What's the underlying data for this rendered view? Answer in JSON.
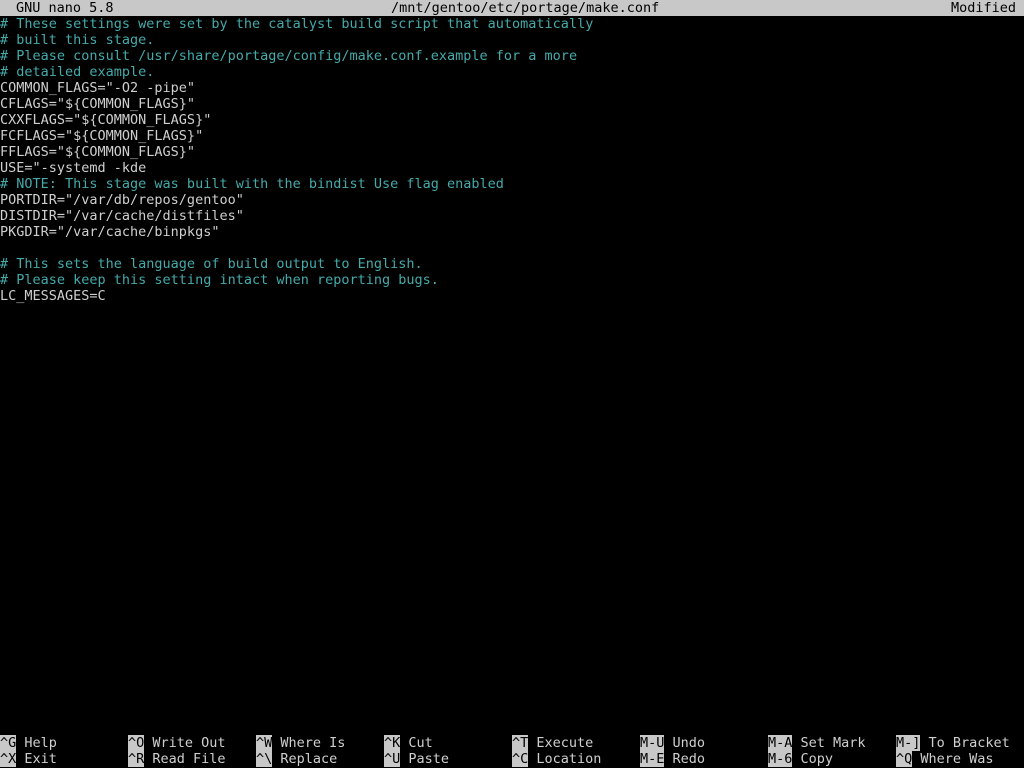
{
  "titlebar": {
    "app": "GNU nano 5.8",
    "file": "/mnt/gentoo/etc/portage/make.conf",
    "status": "Modified"
  },
  "editor": {
    "lines": [
      {
        "text": "# These settings were set by the catalyst build script that automatically",
        "kind": "comment"
      },
      {
        "text": "# built this stage.",
        "kind": "comment"
      },
      {
        "text": "# Please consult /usr/share/portage/config/make.conf.example for a more",
        "kind": "comment"
      },
      {
        "text": "# detailed example.",
        "kind": "comment"
      },
      {
        "text": "COMMON_FLAGS=\"-O2 -pipe\"",
        "kind": "code"
      },
      {
        "text": "CFLAGS=\"${COMMON_FLAGS}\"",
        "kind": "code"
      },
      {
        "text": "CXXFLAGS=\"${COMMON_FLAGS}\"",
        "kind": "code"
      },
      {
        "text": "FCFLAGS=\"${COMMON_FLAGS}\"",
        "kind": "code"
      },
      {
        "text": "FFLAGS=\"${COMMON_FLAGS}\"",
        "kind": "code"
      },
      {
        "text": "USE=\"-systemd -kde",
        "kind": "code"
      },
      {
        "text": "# NOTE: This stage was built with the bindist Use flag enabled",
        "kind": "comment"
      },
      {
        "text": "PORTDIR=\"/var/db/repos/gentoo\"",
        "kind": "code"
      },
      {
        "text": "DISTDIR=\"/var/cache/distfiles\"",
        "kind": "code"
      },
      {
        "text": "PKGDIR=\"/var/cache/binpkgs\"",
        "kind": "code"
      },
      {
        "text": "",
        "kind": "blank"
      },
      {
        "text": "# This sets the language of build output to English.",
        "kind": "comment"
      },
      {
        "text": "# Please keep this setting intact when reporting bugs.",
        "kind": "comment"
      },
      {
        "text": "LC_MESSAGES=C",
        "kind": "code"
      }
    ]
  },
  "shortcuts": [
    {
      "key": "^G",
      "label": "Help"
    },
    {
      "key": "^X",
      "label": "Exit"
    },
    {
      "key": "^O",
      "label": "Write Out"
    },
    {
      "key": "^R",
      "label": "Read File"
    },
    {
      "key": "^W",
      "label": "Where Is"
    },
    {
      "key": "^\\",
      "label": "Replace"
    },
    {
      "key": "^K",
      "label": "Cut"
    },
    {
      "key": "^U",
      "label": "Paste"
    },
    {
      "key": "^T",
      "label": "Execute"
    },
    {
      "key": "^C",
      "label": "Location"
    },
    {
      "key": "M-U",
      "label": "Undo"
    },
    {
      "key": "M-E",
      "label": "Redo"
    },
    {
      "key": "M-A",
      "label": "Set Mark"
    },
    {
      "key": "M-6",
      "label": "Copy"
    },
    {
      "key": "M-]",
      "label": "To Bracket"
    },
    {
      "key": "^Q",
      "label": "Where Was"
    }
  ]
}
